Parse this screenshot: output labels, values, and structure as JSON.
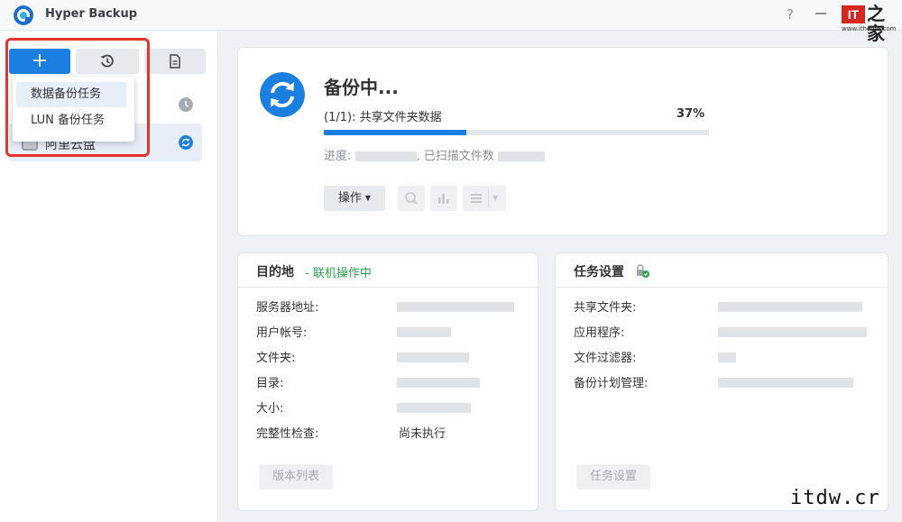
{
  "app": {
    "title": "Hyper Backup",
    "help_label": "?"
  },
  "watermark": {
    "logo_text": "IT",
    "logo_zh": "之家",
    "logo_url": "www.ithome.com",
    "corner_text": "itdw.cr"
  },
  "toolbar": {
    "add_label": "+"
  },
  "dropdown": {
    "items": [
      "数据备份任务",
      "LUN 备份任务"
    ]
  },
  "tasks": [
    {
      "name": "",
      "status": "clock"
    },
    {
      "name": "阿里云盘",
      "status": "syncing"
    }
  ],
  "status": {
    "title": "备份中...",
    "progress_label": "(1/1): 共享文件夹数据",
    "progress_percent_text": "37%",
    "progress_fraction": 0.37,
    "detail_prefix": "进度:",
    "detail_mid": ", 已扫描文件数",
    "ops_label": "操作"
  },
  "destination": {
    "title": "目的地",
    "status": "- 联机操作中",
    "rows": [
      {
        "label": "服务器地址:",
        "value": ""
      },
      {
        "label": "用户帐号:",
        "value": ""
      },
      {
        "label": "文件夹:",
        "value": ""
      },
      {
        "label": "目录:",
        "value": ""
      },
      {
        "label": "大小:",
        "value": ""
      },
      {
        "label": "完整性检查:",
        "value": "尚未执行"
      }
    ],
    "button": "版本列表"
  },
  "task_settings": {
    "title": "任务设置",
    "rows": [
      {
        "label": "共享文件夹:"
      },
      {
        "label": "应用程序:"
      },
      {
        "label": "文件过滤器:"
      },
      {
        "label": "备份计划管理:"
      }
    ],
    "button": "任务设置"
  },
  "colors": {
    "accent": "#1a7fe0",
    "online": "#2aa34a",
    "highlight": "#e5342e"
  }
}
